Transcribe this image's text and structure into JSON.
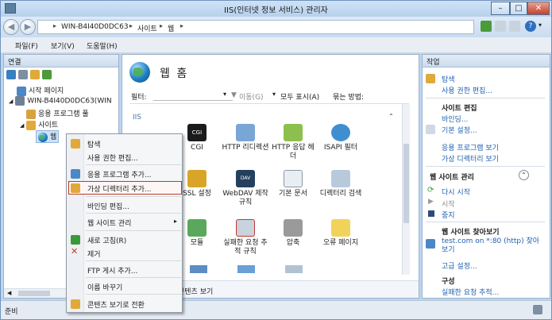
{
  "window": {
    "title": "IIS(인터넷 정보 서비스) 관리자"
  },
  "address": {
    "crumbs": [
      "WIN-B4I40D0DC63",
      "사이트",
      "웹"
    ]
  },
  "menu": {
    "items": [
      "파일(F)",
      "보기(V)",
      "도움말(H)"
    ]
  },
  "connections": {
    "header": "연결",
    "tree": [
      "시작 페이지",
      "WIN-B4I40D0DC63(WIN",
      "응용 프로그램 풀",
      "사이트",
      "웹"
    ]
  },
  "center": {
    "title": "웹 홈",
    "filter_label": "필터:",
    "go_label": "이동(G)",
    "show_all": "모두 표시(A)",
    "group_by": "묶는 방법:",
    "group_header": "IIS",
    "features": [
      {
        "label": "CGI",
        "icon": "cgi-icon"
      },
      {
        "label": "HTTP 리디렉션",
        "icon": "http-redirect-icon"
      },
      {
        "label": "HTTP 응답 헤더",
        "icon": "http-response-headers-icon"
      },
      {
        "label": "ISAPI 필터",
        "icon": "isapi-filter-icon"
      },
      {
        "label": "SSL 설정",
        "icon": "ssl-settings-icon"
      },
      {
        "label": "WebDAV 제작 규칙",
        "icon": "webdav-icon"
      },
      {
        "label": "기본 문서",
        "icon": "default-document-icon"
      },
      {
        "label": "디렉터리 검색",
        "icon": "directory-browsing-icon"
      },
      {
        "label": "모듈",
        "icon": "modules-icon"
      },
      {
        "label": "실패한 요청 추적 규칙",
        "icon": "failed-request-icon"
      },
      {
        "label": "압축",
        "icon": "compression-icon"
      },
      {
        "label": "오류 페이지",
        "icon": "error-pages-icon"
      }
    ],
    "bottom_tab": "콘텐츠 보기"
  },
  "context_menu": {
    "items": [
      "탐색",
      "사용 권한 편집...",
      "응용 프로그램 추가...",
      "가상 디렉터리 추가...",
      "바인딩 편집...",
      "웹 사이트 관리",
      "새로 고침(R)",
      "제거",
      "FTP 게시 추가...",
      "이름 바꾸기",
      "콘텐츠 보기로 전환"
    ],
    "highlighted_index": 3
  },
  "actions": {
    "header": "작업",
    "explore": "탐색",
    "edit_permissions": "사용 권한 편집...",
    "site_edit_header": "사이트 편집",
    "bindings": "바인딩...",
    "basic_settings": "기본 설정...",
    "view_apps": "응용 프로그램 보기",
    "view_vdirs": "가상 디렉터리 보기",
    "manage_header": "웹 사이트 관리",
    "restart": "다시 시작",
    "start": "시작",
    "stop": "중지",
    "browse_header": "웹 사이트 찾아보기",
    "browse_link": "test.com on *:80 (http) 찾아보기",
    "advanced": "고급 설정...",
    "config_header": "구성",
    "failed_trace": "실패한 요청 추적..."
  },
  "status": {
    "text": "준비"
  },
  "colors": {
    "accent": "#1f5fb0",
    "highlight_border": "#c0392b"
  }
}
